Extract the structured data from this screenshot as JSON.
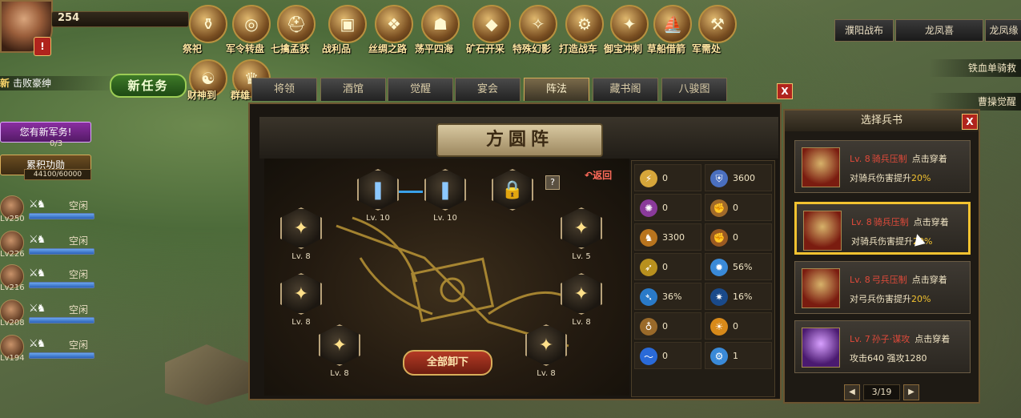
{
  "hud": {
    "level": "254",
    "alert": "!",
    "quest_lead": "新",
    "quest_text": "击败豪绅",
    "new_task": "新任务",
    "military_affairs": "您有新军务!",
    "military_count": "0/3",
    "merit_label": "累积功勋",
    "merit_value": "44100/60000"
  },
  "generals": [
    {
      "level": "Lv250",
      "status": "空闲",
      "bar": 1.0
    },
    {
      "level": "Lv226",
      "status": "空闲",
      "bar": 1.0
    },
    {
      "level": "Lv216",
      "status": "空闲",
      "bar": 1.0
    },
    {
      "level": "Lv208",
      "status": "空闲",
      "bar": 1.0
    },
    {
      "level": "Lv194",
      "status": "空闲",
      "bar": 1.0
    }
  ],
  "features_row1": [
    {
      "label": "祭祀",
      "icon": "altar-icon"
    },
    {
      "label": "军令转盘",
      "icon": "wheel-icon"
    },
    {
      "label": "七擒孟获",
      "icon": "helmet-icon"
    },
    {
      "label": "战利品",
      "icon": "treasure-icon"
    },
    {
      "label": "丝绸之路",
      "icon": "silk-icon"
    },
    {
      "label": "荡平四海",
      "icon": "warrior-icon"
    },
    {
      "label": "矿石开采",
      "icon": "ore-icon"
    },
    {
      "label": "特殊幻影",
      "icon": "phantom-icon"
    },
    {
      "label": "打造战车",
      "icon": "chariot-icon"
    },
    {
      "label": "御宝冲刺",
      "icon": "treasure-sprint-icon"
    },
    {
      "label": "草船借箭",
      "icon": "boat-icon"
    },
    {
      "label": "军需处",
      "icon": "supply-icon"
    }
  ],
  "features_row2": [
    {
      "label": "财神到",
      "icon": "fortune-god-icon"
    },
    {
      "label": "群雄",
      "icon": "heroes-icon"
    }
  ],
  "top_right_tabs": [
    "濮阳战布",
    "龙凤喜",
    "龙凤缘"
  ],
  "right_side_buttons": [
    "铁血单骑救",
    "曹操觉醒"
  ],
  "tabs": [
    "将领",
    "酒馆",
    "觉醒",
    "宴会",
    "阵法",
    "藏书阁",
    "八骏图"
  ],
  "active_tab": "阵法",
  "panel_close": "X",
  "formation": {
    "title": "方圆阵",
    "return_label": "返回",
    "help": "?",
    "unload_all": "全部卸下",
    "slots": [
      {
        "name": "top-left-slot",
        "level": "Lv. 10",
        "kind": "blue"
      },
      {
        "name": "top-middle-slot",
        "level": "Lv. 10",
        "kind": "blue"
      },
      {
        "name": "locked-slot",
        "level": "",
        "kind": "locked"
      },
      {
        "name": "left-upper-slot",
        "level": "Lv. 8",
        "kind": "gold"
      },
      {
        "name": "right-upper-slot",
        "level": "Lv. 5",
        "kind": "gold"
      },
      {
        "name": "left-middle-slot",
        "level": "Lv. 8",
        "kind": "gold"
      },
      {
        "name": "right-middle-slot",
        "level": "Lv. 8",
        "kind": "gold"
      },
      {
        "name": "left-lower-slot",
        "level": "Lv. 8",
        "kind": "gold"
      },
      {
        "name": "right-lower-slot",
        "level": "Lv. 8",
        "kind": "gold"
      }
    ]
  },
  "stats": [
    {
      "icon": "attack-icon",
      "value": "0",
      "color": "#d6a63a"
    },
    {
      "icon": "defense-icon",
      "value": "3600",
      "color": "#4a6fbf"
    },
    {
      "icon": "magic-icon",
      "value": "0",
      "color": "#8a3a9a"
    },
    {
      "icon": "strength-icon",
      "value": "0",
      "color": "#a06a2a"
    },
    {
      "icon": "cavalry-icon",
      "value": "3300",
      "color": "#b8741e"
    },
    {
      "icon": "fist-icon",
      "value": "0",
      "color": "#9a5a22"
    },
    {
      "icon": "bow-icon",
      "value": "0",
      "color": "#b8901e"
    },
    {
      "icon": "crit-icon",
      "value": "56%",
      "color": "#3a8ad8"
    },
    {
      "icon": "dodge-icon",
      "value": "36%",
      "color": "#2a7ac8"
    },
    {
      "icon": "hit-icon",
      "value": "16%",
      "color": "#1a4a8a"
    },
    {
      "icon": "block-icon",
      "value": "0",
      "color": "#9a6a2a"
    },
    {
      "icon": "sun-icon",
      "value": "0",
      "color": "#d88a1a"
    },
    {
      "icon": "wave-icon",
      "value": "0",
      "color": "#2a6ad8"
    },
    {
      "icon": "gear-icon",
      "value": "1",
      "color": "#3a8ad8"
    }
  ],
  "book_panel": {
    "title": "选择兵书",
    "close": "X",
    "books": [
      {
        "level": "Lv. 8",
        "name": "骑兵压制",
        "action": "点击穿着",
        "desc": "对骑兵伤害提升",
        "pct": "20%",
        "selected": false,
        "kind": "gold"
      },
      {
        "level": "Lv. 8",
        "name": "骑兵压制",
        "action": "点击穿着",
        "desc": "对骑兵伤害提升",
        "pct": "20%",
        "selected": true,
        "kind": "gold"
      },
      {
        "level": "Lv. 8",
        "name": "弓兵压制",
        "action": "点击穿着",
        "desc": "对弓兵伤害提升",
        "pct": "20%",
        "selected": false,
        "kind": "gold"
      },
      {
        "level": "Lv. 7",
        "name": "孙子·谋攻",
        "action": "点击穿着",
        "desc": "攻击640 强攻1280",
        "pct": "",
        "selected": false,
        "kind": "purple"
      }
    ],
    "page": "3/19",
    "prev": "◀",
    "next": "▶"
  }
}
